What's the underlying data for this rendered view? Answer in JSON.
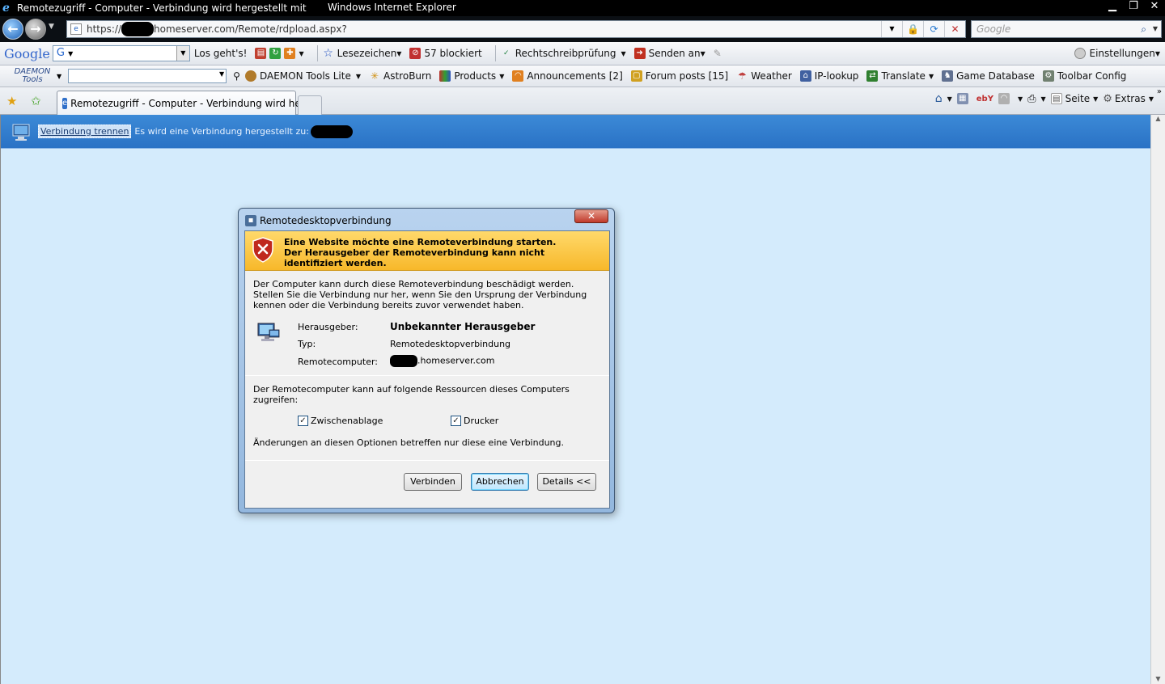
{
  "window": {
    "title": "Remotezugriff - Computer - Verbindung wird hergestellt mit",
    "app_name": "Windows Internet Explorer",
    "controls": [
      "minimize",
      "restore",
      "close"
    ]
  },
  "address_bar": {
    "url_prefix": "https://",
    "url_suffix": "homeserver.com/Remote/rdpload.aspx?",
    "search_placeholder": "Google"
  },
  "google_toolbar": {
    "logo": "Google",
    "search_value": "G",
    "go_label": "Los geht's!",
    "bookmarks_label": "Lesezeichen",
    "blocked_label": "57 blockiert",
    "spellcheck_label": "Rechtschreibprüfung",
    "send_label": "Senden an",
    "settings_label": "Einstellungen"
  },
  "daemon_toolbar": {
    "logo_line1": "DAEMON",
    "logo_line2": "Tools",
    "items": [
      {
        "label": "DAEMON Tools Lite",
        "icon": "daemon-icon",
        "color": "#b07a2a"
      },
      {
        "label": "AstroBurn",
        "icon": "astroburn-icon",
        "color": "#d09010"
      },
      {
        "label": "Products",
        "icon": "products-icon",
        "color": "#c03030"
      },
      {
        "label": "Announcements [2]",
        "icon": "rss-icon",
        "color": "#e08020"
      },
      {
        "label": "Forum posts [15]",
        "icon": "forum-icon",
        "color": "#d0a020"
      },
      {
        "label": "Weather",
        "icon": "weather-icon",
        "color": "#c04040"
      },
      {
        "label": "IP-lookup",
        "icon": "ip-icon",
        "color": "#4060a0"
      },
      {
        "label": "Translate",
        "icon": "translate-icon",
        "color": "#308030"
      },
      {
        "label": "Game Database",
        "icon": "game-icon",
        "color": "#607090"
      },
      {
        "label": "Toolbar Config",
        "icon": "config-icon",
        "color": "#708070"
      }
    ]
  },
  "tabs": {
    "active_label": "Remotezugriff - Computer - Verbindung wird her...",
    "page_label": "Seite",
    "extras_label": "Extras"
  },
  "page": {
    "disconnect_label": "Verbindung trennen",
    "status_text": "Es wird eine Verbindung hergestellt zu:"
  },
  "dialog": {
    "title": "Remotedesktopverbindung",
    "close_label": "✕",
    "warning": "Eine Website möchte eine Remoteverbindung starten. Der Herausgeber der Remoteverbindung kann nicht identifiziert werden.",
    "description": "Der Computer kann durch diese Remoteverbindung beschädigt werden. Stellen Sie die Verbindung nur her, wenn Sie den Ursprung der Verbindung kennen oder die Verbindung bereits zuvor verwendet haben.",
    "publisher_label": "Herausgeber:",
    "publisher_value": "Unbekannter Herausgeber",
    "type_label": "Typ:",
    "type_value": "Remotedesktopverbindung",
    "remote_label": "Remotecomputer:",
    "remote_value": ".homeserver.com",
    "resources_text": "Der Remotecomputer kann auf folgende Ressourcen dieses Computers zugreifen:",
    "clipboard_label": "Zwischenablage",
    "printer_label": "Drucker",
    "note": "Änderungen an diesen Optionen betreffen nur diese eine Verbindung.",
    "connect_label": "Verbinden",
    "cancel_label": "Abbrechen",
    "details_label": "Details <<"
  }
}
